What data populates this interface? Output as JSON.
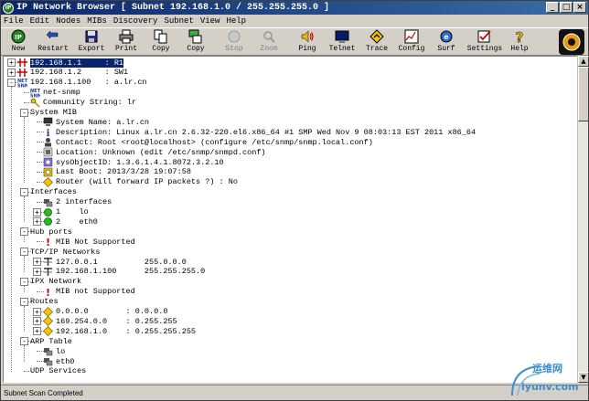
{
  "window": {
    "title": "IP Network Browser [ Subnet 192.168.1.0 / 255.255.255.0 ]",
    "controls": [
      "minimize",
      "maximize",
      "close"
    ]
  },
  "menu": [
    "File",
    "Edit",
    "Nodes",
    "MIBs",
    "Discovery",
    "Subnet",
    "View",
    "Help"
  ],
  "toolbar": [
    {
      "label": "New",
      "icon": "ip-new-icon",
      "enabled": true
    },
    {
      "label": "Restart",
      "icon": "restart-arrow-icon",
      "enabled": true
    },
    {
      "label": "Export",
      "icon": "export-disk-icon",
      "enabled": true
    },
    {
      "label": "Print",
      "icon": "printer-icon",
      "enabled": true
    },
    {
      "label": "Copy",
      "icon": "copy-icon",
      "enabled": true
    },
    {
      "label": "Copy",
      "icon": "copy-green-icon",
      "enabled": true
    },
    {
      "label": "Stop",
      "icon": "stop-icon",
      "enabled": false
    },
    {
      "label": "Zoom",
      "icon": "zoom-icon",
      "enabled": false
    },
    {
      "label": "Ping",
      "icon": "ping-speaker-icon",
      "enabled": true
    },
    {
      "label": "Telnet",
      "icon": "telnet-monitor-icon",
      "enabled": true
    },
    {
      "label": "Trace",
      "icon": "trace-diamond-icon",
      "enabled": true
    },
    {
      "label": "Config",
      "icon": "config-chart-icon",
      "enabled": true
    },
    {
      "label": "Surf",
      "icon": "surf-globe-icon",
      "enabled": true
    },
    {
      "label": "Settings",
      "icon": "settings-check-icon",
      "enabled": true
    },
    {
      "label": "Help",
      "icon": "help-question-icon",
      "enabled": true
    }
  ],
  "tree": [
    {
      "level": 0,
      "exp": "+",
      "icon": "router",
      "text": "192.168.1.1     : R1",
      "selected": true
    },
    {
      "level": 0,
      "exp": "+",
      "icon": "router",
      "text": "192.168.1.2     : SW1"
    },
    {
      "level": 0,
      "exp": "-",
      "icon": "snmp",
      "text": "192.168.1.100   : a.lr.cn"
    },
    {
      "level": 1,
      "exp": "",
      "icon": "snmp",
      "text": "net-snmp"
    },
    {
      "level": 1,
      "exp": "",
      "icon": "key",
      "text": "Community String: lr"
    },
    {
      "level": 1,
      "exp": "-",
      "icon": "",
      "text": "System MIB"
    },
    {
      "level": 2,
      "exp": "",
      "icon": "computer",
      "text": "System Name: a.lr.cn"
    },
    {
      "level": 2,
      "exp": "",
      "icon": "info",
      "text": "Description: Linux a.lr.cn 2.6.32-220.el6.x86_64 #1 SMP Wed Nov 9 08:03:13 EST 2011 x86_64"
    },
    {
      "level": 2,
      "exp": "",
      "icon": "contact",
      "text": "Contact: Root <root@localhost> (configure /etc/snmp/snmp.local.conf)"
    },
    {
      "level": 2,
      "exp": "",
      "icon": "location",
      "text": "Location: Unknown (edit /etc/snmp/snmpd.conf)"
    },
    {
      "level": 2,
      "exp": "",
      "icon": "objectid",
      "text": "sysObjectID: 1.3.6.1.4.1.8072.3.2.10"
    },
    {
      "level": 2,
      "exp": "",
      "icon": "boot",
      "text": "Last Boot: 2013/3/28 19:07:58"
    },
    {
      "level": 2,
      "exp": "",
      "icon": "diamond",
      "text": "Router (will forward IP packets ?) : No"
    },
    {
      "level": 1,
      "exp": "-",
      "icon": "",
      "text": "Interfaces"
    },
    {
      "level": 2,
      "exp": "",
      "icon": "network",
      "text": "2 interfaces"
    },
    {
      "level": 2,
      "exp": "+",
      "icon": "green",
      "text": "1    lo"
    },
    {
      "level": 2,
      "exp": "+",
      "icon": "green",
      "text": "2    eth0"
    },
    {
      "level": 1,
      "exp": "-",
      "icon": "",
      "text": "Hub ports"
    },
    {
      "level": 2,
      "exp": "",
      "icon": "excl",
      "text": "MIB Not Supported"
    },
    {
      "level": 1,
      "exp": "-",
      "icon": "",
      "text": "TCP/IP Networks"
    },
    {
      "level": 2,
      "exp": "+",
      "icon": "net",
      "text": "127.0.0.1          255.0.0.0"
    },
    {
      "level": 2,
      "exp": "+",
      "icon": "net",
      "text": "192.168.1.100      255.255.255.0"
    },
    {
      "level": 1,
      "exp": "-",
      "icon": "",
      "text": "IPX Network"
    },
    {
      "level": 2,
      "exp": "",
      "icon": "excl",
      "text": "MIB not Supported"
    },
    {
      "level": 1,
      "exp": "-",
      "icon": "",
      "text": "Routes"
    },
    {
      "level": 2,
      "exp": "+",
      "icon": "diamond",
      "text": "0.0.0.0        : 0.0.0.0"
    },
    {
      "level": 2,
      "exp": "+",
      "icon": "diamond",
      "text": "169.254.0.0    : 0.255.255"
    },
    {
      "level": 2,
      "exp": "+",
      "icon": "diamond",
      "text": "192.168.1.0    : 0.255.255.255"
    },
    {
      "level": 1,
      "exp": "-",
      "icon": "",
      "text": "ARP Table"
    },
    {
      "level": 2,
      "exp": "",
      "icon": "network",
      "text": "lo"
    },
    {
      "level": 2,
      "exp": "",
      "icon": "network",
      "text": "eth0"
    },
    {
      "level": 1,
      "exp": "",
      "icon": "",
      "text": "UDP Services"
    }
  ],
  "status": "Subnet Scan Completed",
  "watermark": {
    "line1": "运维网",
    "line2": "iyunv.com"
  }
}
